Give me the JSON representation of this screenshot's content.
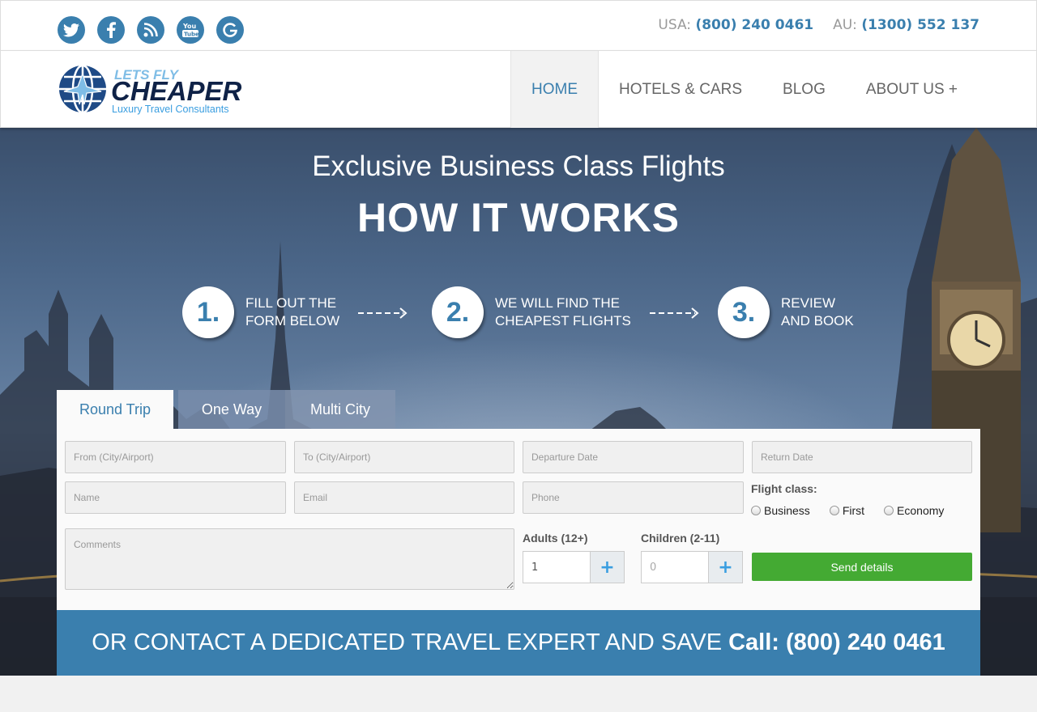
{
  "header": {
    "socials": [
      {
        "icon": "twitter-icon"
      },
      {
        "icon": "facebook-icon"
      },
      {
        "icon": "rss-icon"
      },
      {
        "icon": "youtube-icon"
      },
      {
        "icon": "google-icon"
      }
    ],
    "phone_usa_label": "USA:",
    "phone_usa": "(800) 240 0461",
    "phone_au_label": "AU:",
    "phone_au": "(1300) 552 137"
  },
  "logo": {
    "line1": "LETS FLY",
    "line2": "CHEAPER",
    "tagline": "Luxury Travel Consultants"
  },
  "nav": {
    "items": [
      {
        "label": "HOME",
        "active": true
      },
      {
        "label": "HOTELS & CARS"
      },
      {
        "label": "BLOG"
      },
      {
        "label": "ABOUT US +"
      }
    ]
  },
  "hero": {
    "subtitle": "Exclusive Business Class Flights",
    "title": "HOW IT WORKS",
    "steps": [
      {
        "number": "1.",
        "text": "FILL OUT THE\nFORM BELOW"
      },
      {
        "number": "2.",
        "text": "WE WILL FIND THE\nCHEAPEST FLIGHTS"
      },
      {
        "number": "3.",
        "text": "REVIEW\nAND BOOK"
      }
    ]
  },
  "tabs": [
    {
      "label": "Round Trip",
      "active": true
    },
    {
      "label": "One Way"
    },
    {
      "label": "Multi City"
    }
  ],
  "form": {
    "from_placeholder": "From (City/Airport)",
    "to_placeholder": "To (City/Airport)",
    "departure_placeholder": "Departure Date",
    "return_placeholder": "Return Date",
    "name_placeholder": "Name",
    "email_placeholder": "Email",
    "phone_placeholder": "Phone",
    "comments_placeholder": "Comments",
    "flight_class_label": "Flight class:",
    "flight_classes": [
      "Business",
      "First",
      "Economy"
    ],
    "adults_label": "Adults (12+)",
    "adults_value": "1",
    "children_label": "Children (2-11)",
    "children_value": "0",
    "stepper_plus": "+",
    "send_label": "Send details"
  },
  "contact": {
    "text": "OR CONTACT A DEDICATED TRAVEL EXPERT AND SAVE",
    "call": "Call: (800) 240 0461"
  },
  "colors": {
    "accent": "#3a7fae",
    "send_button": "#44aa33"
  }
}
